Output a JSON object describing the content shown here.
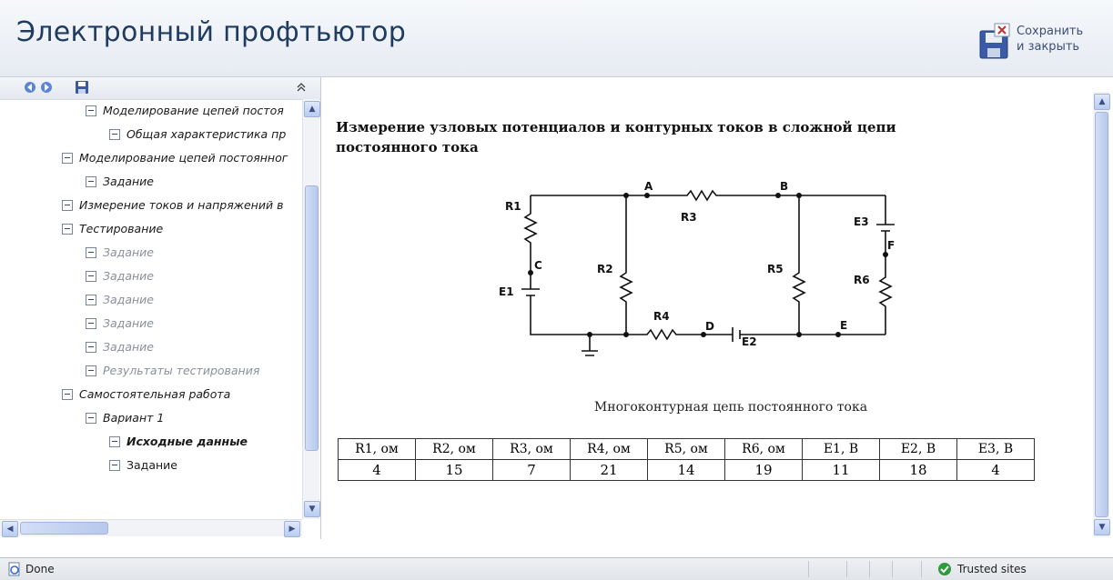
{
  "header": {
    "title": "Электронный профтьютор",
    "save_label": "Сохранить\nи закрыть"
  },
  "nav": {
    "items": [
      {
        "label": "Моделирование цепей постоя"
      },
      {
        "label": "Общая характеристика пр"
      },
      {
        "label": "Моделирование цепей постоянног"
      },
      {
        "label": "Задание"
      },
      {
        "label": "Измерение токов и напряжений в"
      },
      {
        "label": "Тестирование"
      },
      {
        "label": "Задание"
      },
      {
        "label": "Задание"
      },
      {
        "label": "Задание"
      },
      {
        "label": "Задание"
      },
      {
        "label": "Задание"
      },
      {
        "label": "Результаты тестирования"
      },
      {
        "label": "Самостоятельная работа"
      },
      {
        "label": "Вариант 1"
      },
      {
        "label": "Исходные данные"
      },
      {
        "label": "Задание"
      }
    ]
  },
  "content": {
    "title": "Измерение узловых потенциалов и контурных токов в сложной цепи постоянного тока",
    "caption": "Многоконтурная цепь постоянного тока",
    "circuit_labels": {
      "r1": "R1",
      "r2": "R2",
      "r3": "R3",
      "r4": "R4",
      "r5": "R5",
      "r6": "R6",
      "e1": "E1",
      "e2": "E2",
      "e3": "E3",
      "a": "A",
      "b": "B",
      "c": "C",
      "d": "D",
      "e": "E",
      "f": "F"
    },
    "table": {
      "headers": [
        "R1, ом",
        "R2, ом",
        "R3, ом",
        "R4, ом",
        "R5, ом",
        "R6, ом",
        "E1, В",
        "E2, В",
        "E3, В"
      ],
      "values": [
        "4",
        "15",
        "7",
        "21",
        "14",
        "19",
        "11",
        "18",
        "4"
      ]
    }
  },
  "status": {
    "left": "Done",
    "zone": "Trusted sites"
  },
  "colors": {
    "title": "#1f3b60",
    "zone_ok": "#2e9a3a"
  }
}
